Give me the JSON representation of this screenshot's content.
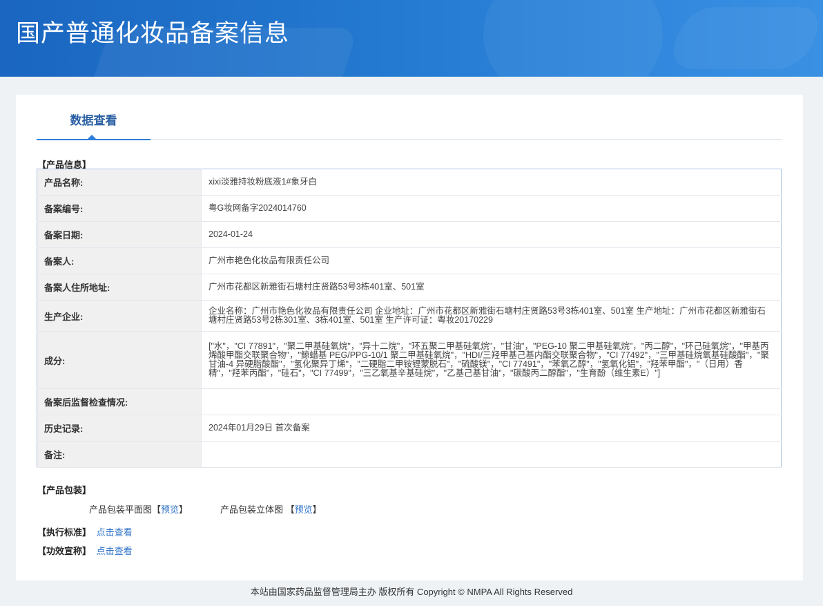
{
  "banner": {
    "title": "国产普通化妆品备案信息"
  },
  "tabs": [
    {
      "label": "数据查看"
    }
  ],
  "product_info": {
    "section_label": "【产品信息】",
    "rows": [
      {
        "key": "产品名称:",
        "value": "xixi淡雅持妆粉底液1#象牙白"
      },
      {
        "key": "备案编号:",
        "value": "粤G妆网备字2024014760"
      },
      {
        "key": "备案日期:",
        "value": "2024-01-24"
      },
      {
        "key": "备案人:",
        "value": "广州市艳色化妆品有限责任公司"
      },
      {
        "key": "备案人住所地址:",
        "value": "广州市花都区新雅街石塘村庄贤路53号3栋401室、501室"
      },
      {
        "key": "生产企业:",
        "value": "企业名称：广州市艳色化妆品有限责任公司 企业地址：广州市花都区新雅街石塘村庄贤路53号3栋401室、501室 生产地址：广州市花都区新雅街石塘村庄贤路53号2栋301室、3栋401室、501室 生产许可证：粤妆20170229"
      },
      {
        "key": "成分:",
        "value": "[\"水\"，\"CI 77891\"，\"聚二甲基硅氧烷\"，\"异十二烷\"，\"环五聚二甲基硅氧烷\"，\"甘油\"，\"PEG-10 聚二甲基硅氧烷\"，\"丙二醇\"，\"环己硅氧烷\"，\"甲基丙烯酸甲酯交联聚合物\"，\"鲸蜡基 PEG/PPG-10/1 聚二甲基硅氧烷\"，\"HDI/三羟甲基己基内酯交联聚合物\"，\"CI 77492\"，\"三甲基硅烷氧基硅酸酯\"，\"聚甘油-4 异硬脂酸酯\"，\"氢化聚异丁烯\"，\"二硬脂二甲铵锂蒙脱石\"，\"硫酸镁\"，\"CI 77491\"，\"苯氧乙醇\"，\"氢氧化铝\"，\"羟苯甲酯\"，\"（日用）香精\"，\"羟苯丙酯\"，\"硅石\"，\"CI 77499\"，\"三乙氧基辛基硅烷\"，\"乙基己基甘油\"，\"碳酸丙二醇酯\"，\"生育酚（维生素E）\"]"
      },
      {
        "key": "备案后监督检查情况:",
        "value": ""
      },
      {
        "key": "历史记录:",
        "value": "2024年01月29日 首次备案"
      },
      {
        "key": "备注:",
        "value": ""
      }
    ]
  },
  "packaging": {
    "section_label": "【产品包装】",
    "flat_label": "产品包装平面图",
    "flat_link": "预览",
    "solid_label": "产品包装立体图",
    "solid_link": "预览",
    "bracket_open": "【",
    "bracket_close": "】"
  },
  "standard": {
    "label": "【执行标准】",
    "link": "点击查看"
  },
  "efficacy": {
    "label": "【功效宣称】",
    "link": "点击查看"
  },
  "footer": {
    "text": "本站由国家药品监督管理局主办 版权所有 Copyright © NMPA All Rights Reserved"
  }
}
